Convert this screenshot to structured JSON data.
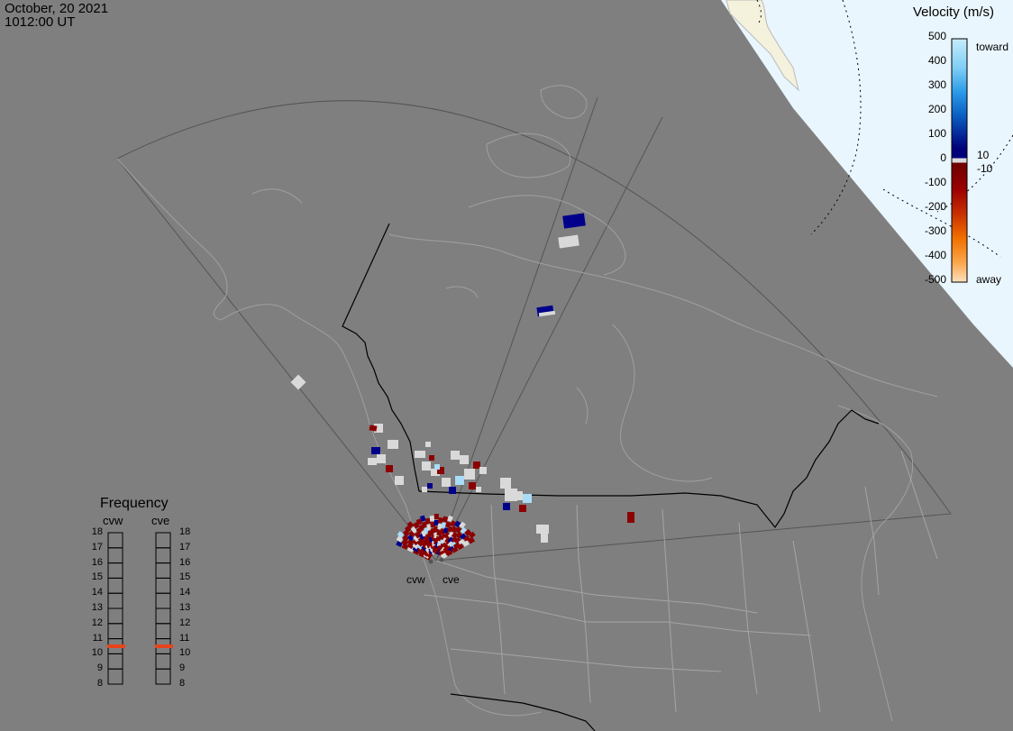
{
  "header": {
    "date": "October, 20 2021",
    "time": "1012:00 UT"
  },
  "velocity_legend": {
    "title": "Velocity (m/s)",
    "ticks": [
      "500",
      "400",
      "300",
      "200",
      "100",
      "0",
      "-100",
      "-200",
      "-300",
      "-400",
      "-500"
    ],
    "toward_label": "toward",
    "away_label": "away",
    "threshold_pos": "10",
    "threshold_neg": "-10"
  },
  "frequency_legend": {
    "title": "Frequency",
    "radar_a": "cvw",
    "radar_b": "cve",
    "levels": [
      "18",
      "17",
      "16",
      "15",
      "14",
      "13",
      "12",
      "11",
      "10",
      "9",
      "8"
    ],
    "cvw_value_mhz": 10.5,
    "cve_value_mhz": 10.5,
    "marker_color": "#e8441c"
  },
  "radars": {
    "west": "cvw",
    "east": "cve"
  },
  "colors": {
    "background": "#7f7f7f",
    "ocean": "#eaf6fd",
    "ground_scatter": "#d9d9d9",
    "away_dark_red": "#8b0000",
    "toward_dark_blue": "#00008b",
    "toward_light": "#a9dcf7"
  }
}
